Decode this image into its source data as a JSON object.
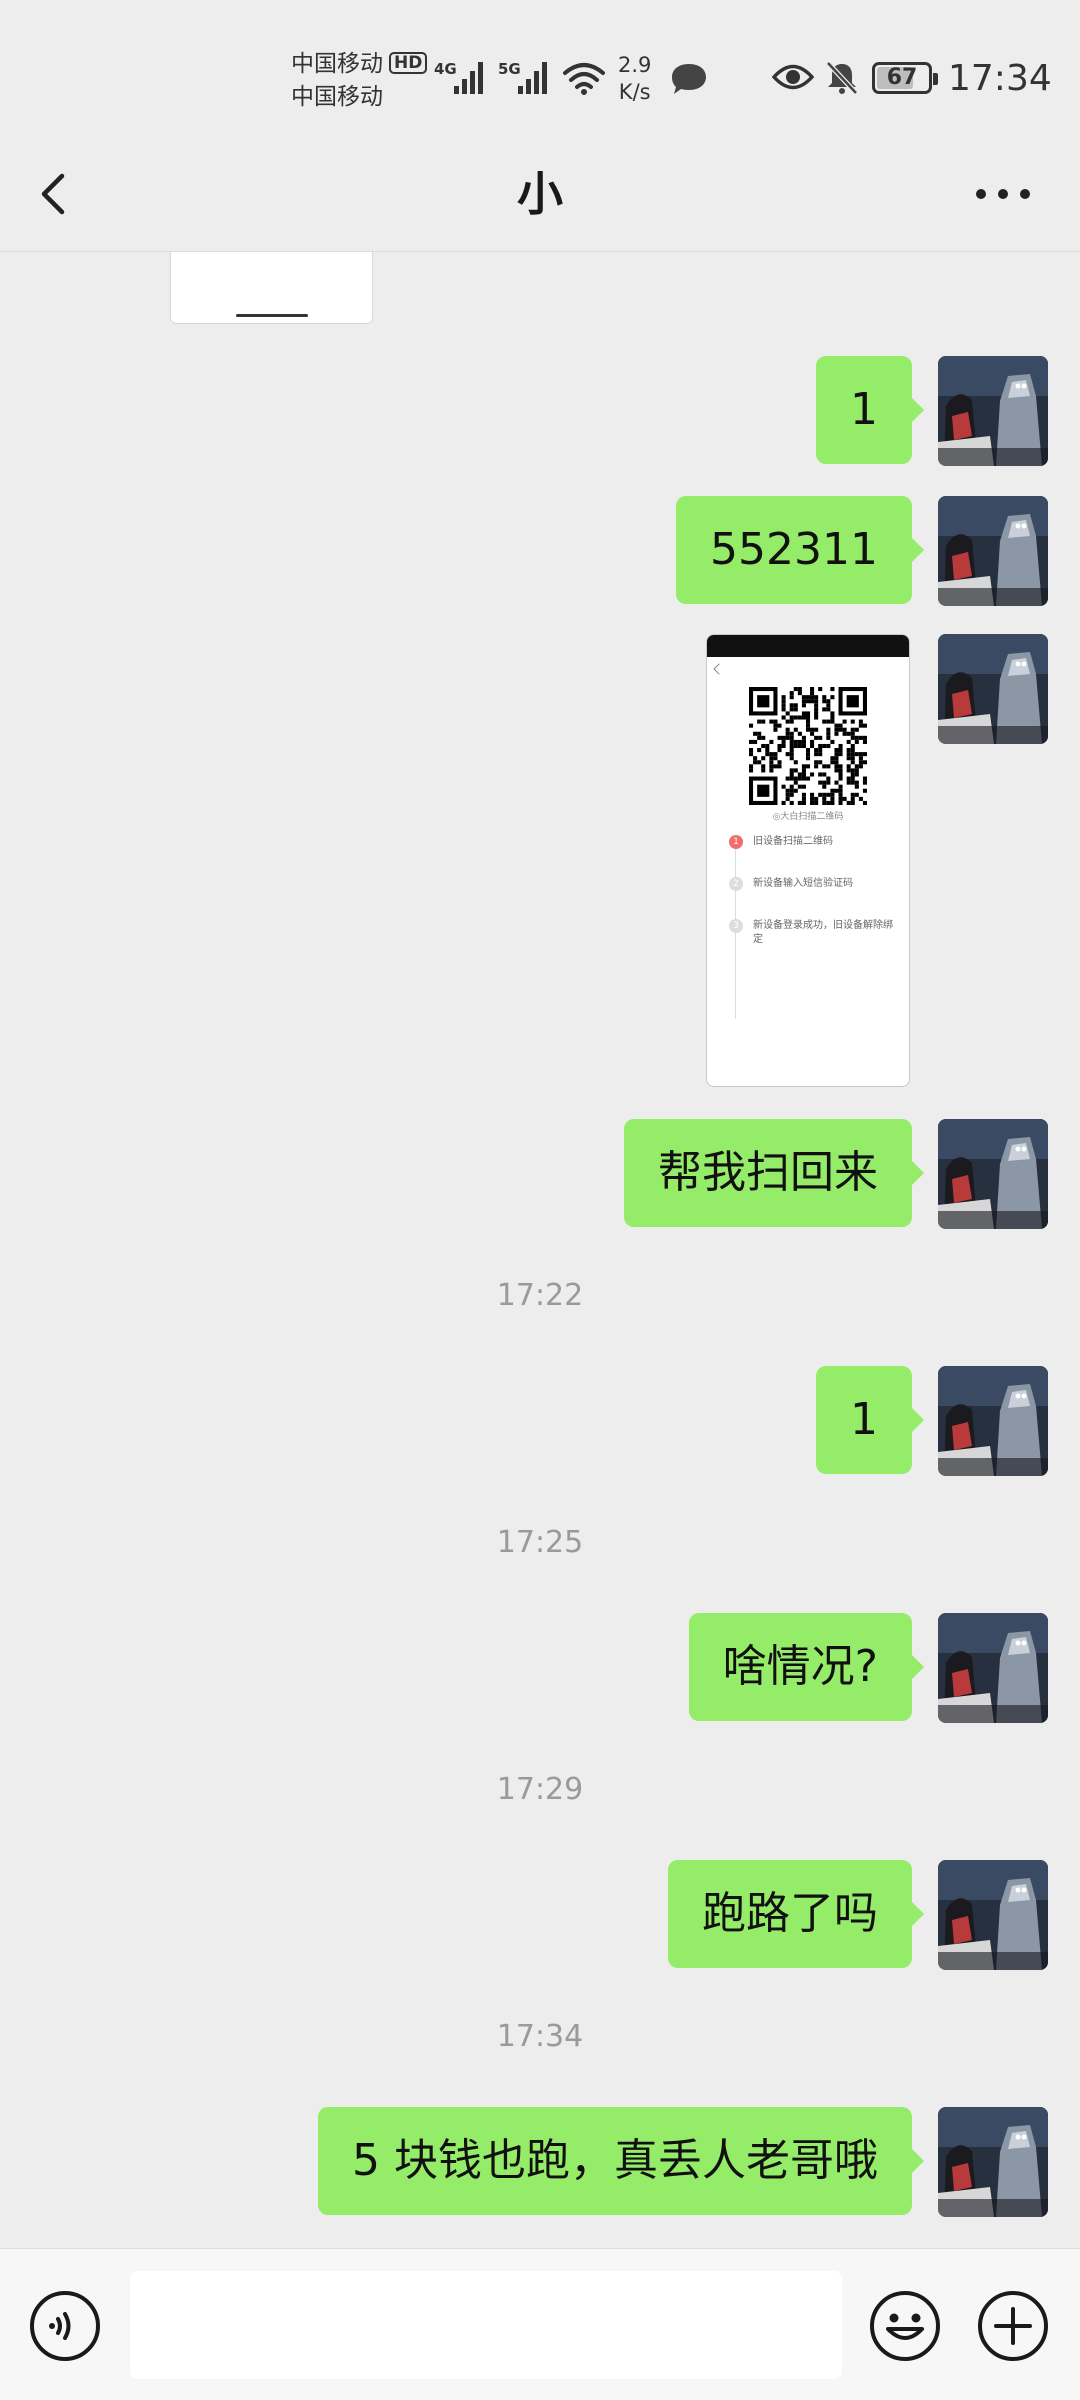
{
  "status_bar": {
    "carrier_1": "中国移动",
    "hd": "HD",
    "carrier_2": "中国移动",
    "net_1": "4G",
    "net_2": "5G",
    "speed_value": "2.9",
    "speed_unit": "K/s",
    "battery": "67",
    "time": "17:34"
  },
  "nav": {
    "title": "小"
  },
  "messages": [
    {
      "type": "text",
      "text": "1"
    },
    {
      "type": "text",
      "text": "552311"
    },
    {
      "type": "image",
      "caption": "◎大白扫描二维码",
      "steps": [
        "旧设备扫描二维码",
        "新设备输入短信验证码",
        "新设备登录成功，旧设备解除绑定"
      ]
    },
    {
      "type": "text",
      "text": "帮我扫回来"
    },
    {
      "type": "time",
      "text": "17:22"
    },
    {
      "type": "text",
      "text": "1"
    },
    {
      "type": "time",
      "text": "17:25"
    },
    {
      "type": "text",
      "text": "啥情况?"
    },
    {
      "type": "time",
      "text": "17:29"
    },
    {
      "type": "text",
      "text": "跑路了吗"
    },
    {
      "type": "time",
      "text": "17:34"
    },
    {
      "type": "text",
      "text": "5 块钱也跑，真丢人老哥哦"
    }
  ],
  "input": {
    "value": "",
    "placeholder": ""
  },
  "icons": {
    "back": "chevron-left-icon",
    "more": "more-dots-icon",
    "voice": "voice-icon",
    "emoji": "emoji-icon",
    "plus": "plus-icon"
  },
  "colors": {
    "bubble": "#95ec69",
    "background": "#ededed",
    "step_active": "#f36b6b"
  }
}
